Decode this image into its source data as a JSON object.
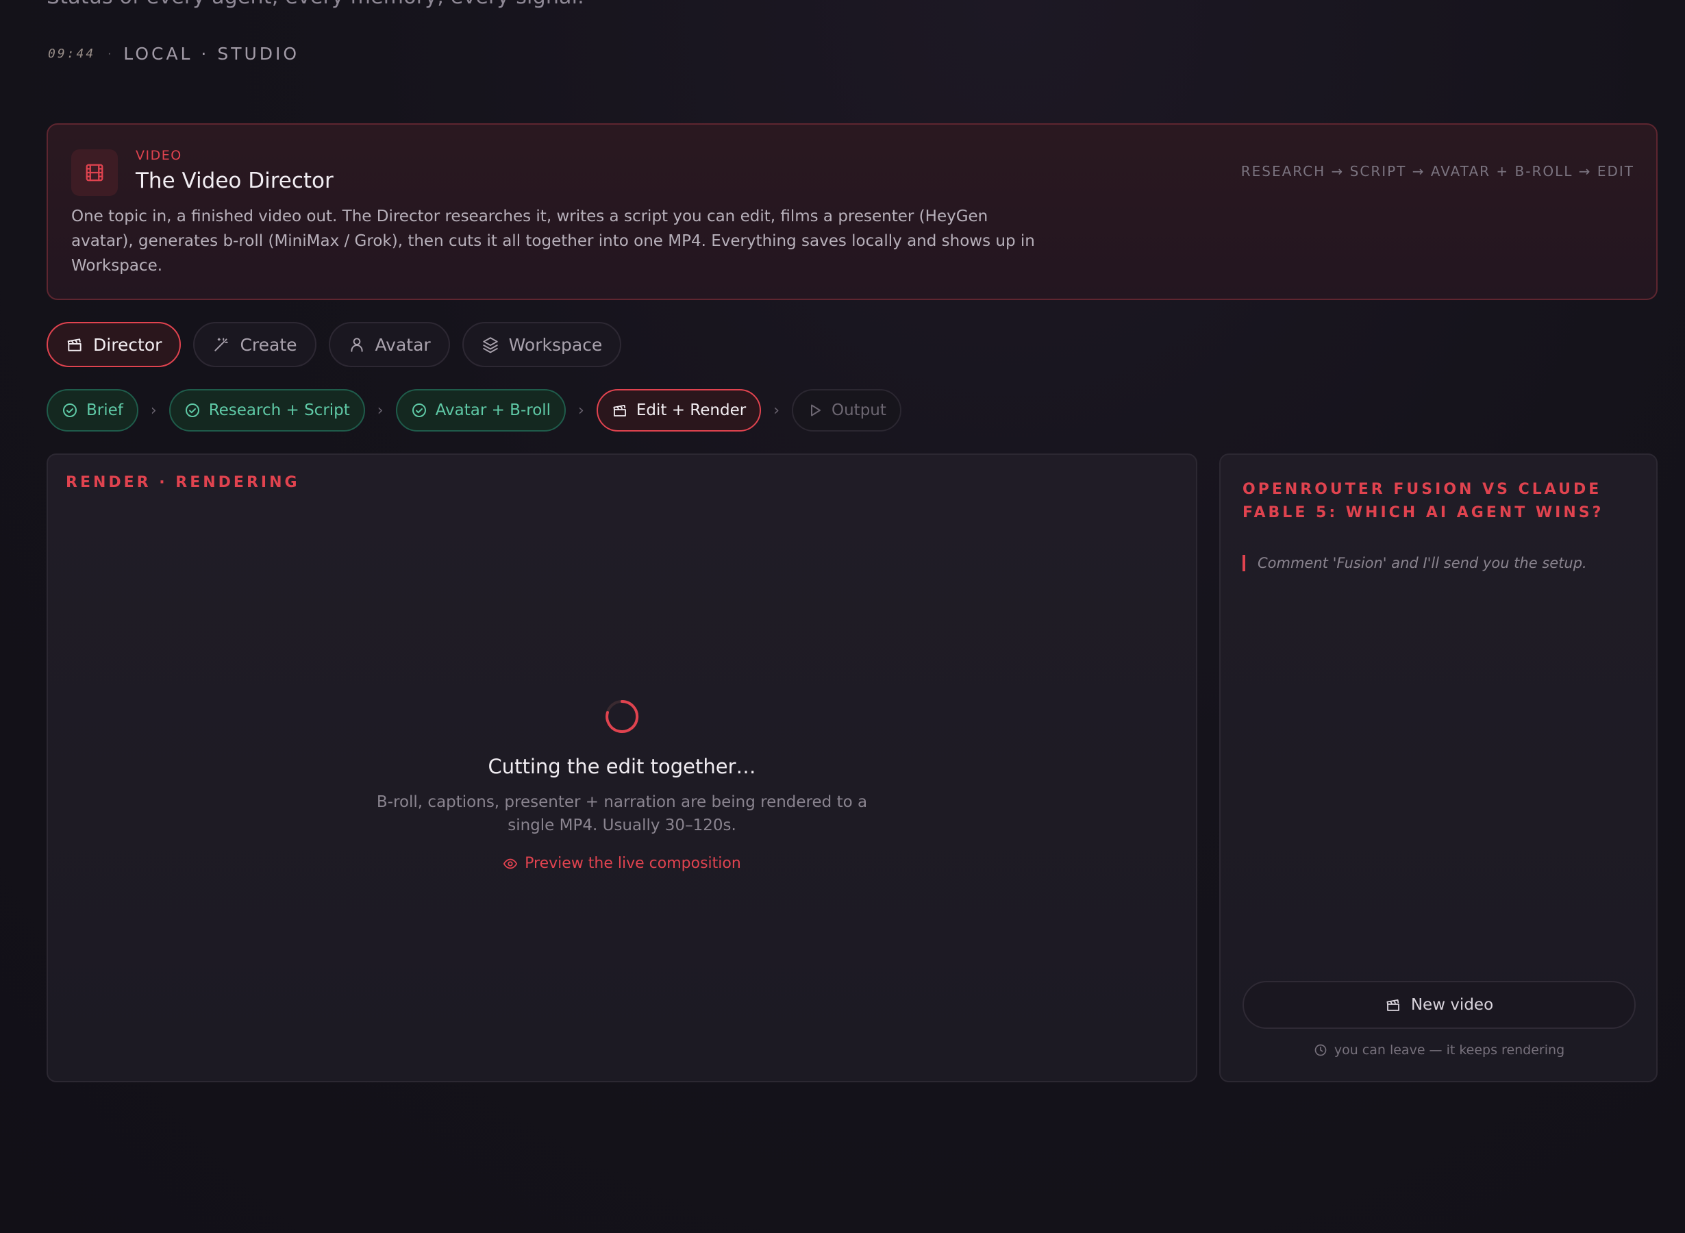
{
  "header": {
    "subtitle": "Status of every agent, every memory, every signal.",
    "clock": "09:44",
    "separator": "·",
    "location": "LOCAL · STUDIO"
  },
  "hero": {
    "icon": "film-icon",
    "kicker": "VIDEO",
    "title": "The Video Director",
    "description": "One topic in, a finished video out. The Director researches it, writes a script you can edit, films a presenter (HeyGen avatar), generates b-roll (MiniMax / Grok), then cuts it all together into one MP4. Everything saves locally and shows up in Workspace.",
    "flow": "RESEARCH → SCRIPT → AVATAR + B-ROLL → EDIT"
  },
  "tabs": [
    {
      "label": "Director",
      "icon": "clapperboard-icon",
      "active": true
    },
    {
      "label": "Create",
      "icon": "magic-wand-icon",
      "active": false
    },
    {
      "label": "Avatar",
      "icon": "user-icon",
      "active": false
    },
    {
      "label": "Workspace",
      "icon": "layers-icon",
      "active": false
    }
  ],
  "steps": [
    {
      "label": "Brief",
      "state": "done",
      "icon": "check-circle-icon"
    },
    {
      "label": "Research + Script",
      "state": "done",
      "icon": "check-circle-icon"
    },
    {
      "label": "Avatar + B-roll",
      "state": "done",
      "icon": "check-circle-icon"
    },
    {
      "label": "Edit + Render",
      "state": "current",
      "icon": "clapperboard-icon"
    },
    {
      "label": "Output",
      "state": "pending",
      "icon": "play-icon"
    }
  ],
  "render_panel": {
    "label": "RENDER · RENDERING",
    "title": "Cutting the edit together…",
    "description": "B-roll, captions, presenter + narration are being rendered to a single MP4. Usually 30–120s.",
    "preview_link": "Preview the live composition"
  },
  "side_panel": {
    "title": "OPENROUTER FUSION VS CLAUDE FABLE 5: WHICH AI AGENT WINS?",
    "quote": "Comment 'Fusion' and I'll send you the setup.",
    "new_video_label": "New video",
    "leave_note": "you can leave — it keeps rendering"
  },
  "colors": {
    "accent": "#e0434f",
    "success": "#5fc9a6",
    "background": "#15131b"
  }
}
